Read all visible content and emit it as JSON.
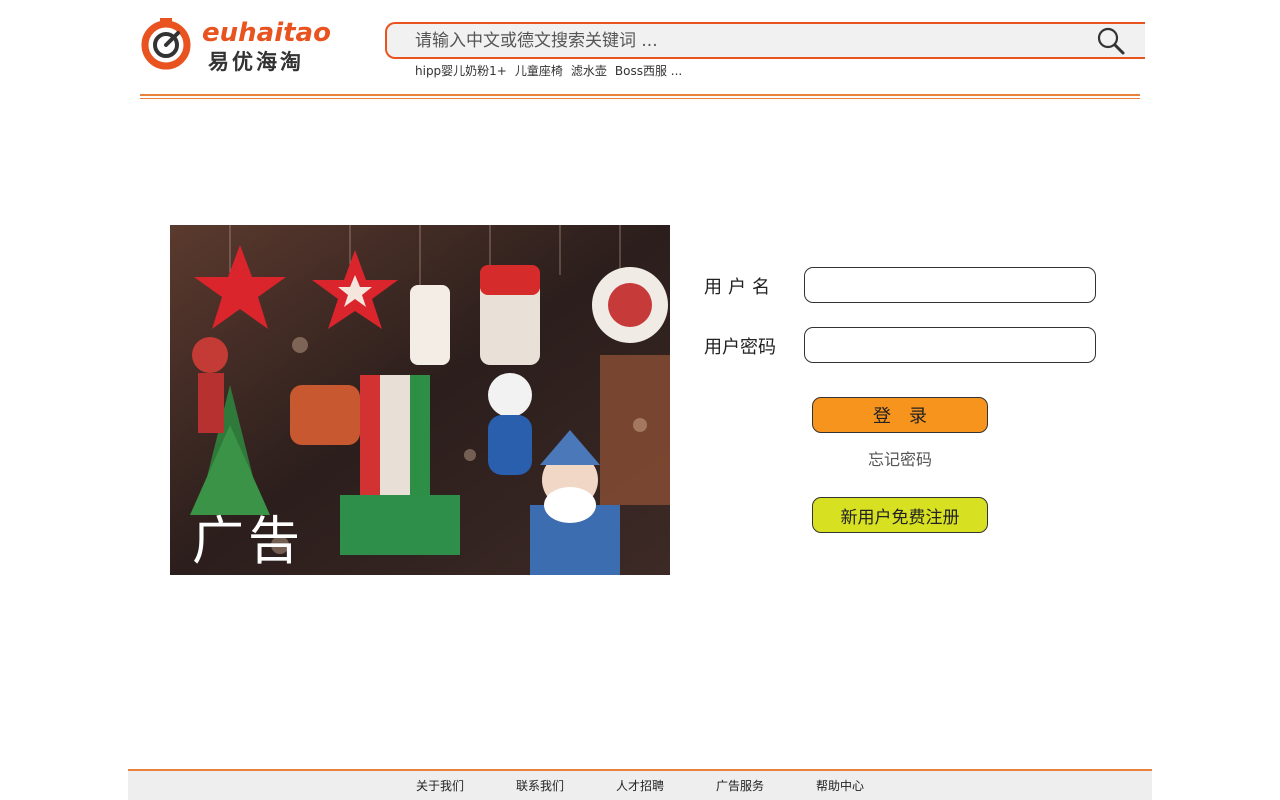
{
  "logo": {
    "brand_en": "euhaitao",
    "brand_cn": "易优海淘",
    "accent_color": "#e8531f"
  },
  "search": {
    "placeholder": "请输入中文或德文搜索关键词 ...",
    "icon": "search-icon",
    "hot_keywords": [
      "hipp婴儿奶粉1+",
      "儿童座椅",
      "滤水壶",
      "Boss西服 ..."
    ]
  },
  "ad": {
    "label": "广告"
  },
  "login": {
    "username_label": "用户名",
    "password_label": "用户密码",
    "login_button": "登录",
    "forgot_password": "忘记密码",
    "register_button": "新用户免费注册",
    "login_color": "#f7941d",
    "register_color": "#d7e021"
  },
  "footer": {
    "links": [
      "关于我们",
      "联系我们",
      "人才招聘",
      "广告服务",
      "帮助中心"
    ]
  }
}
